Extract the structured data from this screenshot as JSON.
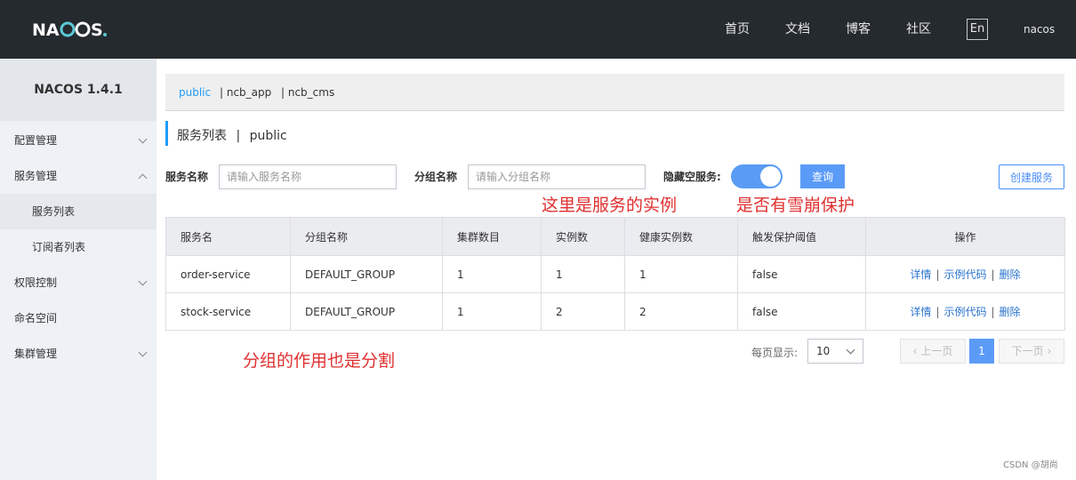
{
  "header": {
    "nav": [
      "首页",
      "文档",
      "博客",
      "社区"
    ],
    "lang": "En",
    "user": "nacos"
  },
  "sidebar": {
    "title": "NACOS 1.4.1",
    "items": [
      {
        "label": "配置管理"
      },
      {
        "label": "服务管理"
      },
      {
        "label": "服务列表"
      },
      {
        "label": "订阅者列表"
      },
      {
        "label": "权限控制"
      },
      {
        "label": "命名空间"
      },
      {
        "label": "集群管理"
      }
    ]
  },
  "namespaces": [
    "public",
    "| ncb_app",
    "| ncb_cms"
  ],
  "page": {
    "title": "服务列表",
    "sep": "|",
    "namespace": "public"
  },
  "filters": {
    "service_label": "服务名称",
    "service_placeholder": "请输入服务名称",
    "group_label": "分组名称",
    "group_placeholder": "请输入分组名称",
    "hide_empty_label": "隐藏空服务:",
    "query_button": "查询",
    "create_button": "创建服务"
  },
  "annotations": {
    "instances": "这里是服务的实例",
    "avalanche": "是否有雪崩保护",
    "group": "分组的作用也是分割"
  },
  "table": {
    "headers": [
      "服务名",
      "分组名称",
      "集群数目",
      "实例数",
      "健康实例数",
      "触发保护阈值",
      "操作"
    ],
    "rows": [
      {
        "name": "order-service",
        "group": "DEFAULT_GROUP",
        "clusters": "1",
        "instances": "1",
        "healthy": "1",
        "threshold": "false"
      },
      {
        "name": "stock-service",
        "group": "DEFAULT_GROUP",
        "clusters": "1",
        "instances": "2",
        "healthy": "2",
        "threshold": "false"
      }
    ],
    "ops": {
      "detail": "详情",
      "sample": "示例代码",
      "delete": "删除",
      "sep": "|"
    }
  },
  "pagination": {
    "per_page_label": "每页显示:",
    "per_page": "10",
    "prev": "上一页",
    "next": "下一页",
    "current": "1"
  },
  "watermark": "CSDN @胡尚",
  "colors": {
    "header_bg": "#252a2f",
    "accent": "#5b9bf8",
    "annotation": "#e02f2f",
    "active_ns": "#209bfa"
  }
}
